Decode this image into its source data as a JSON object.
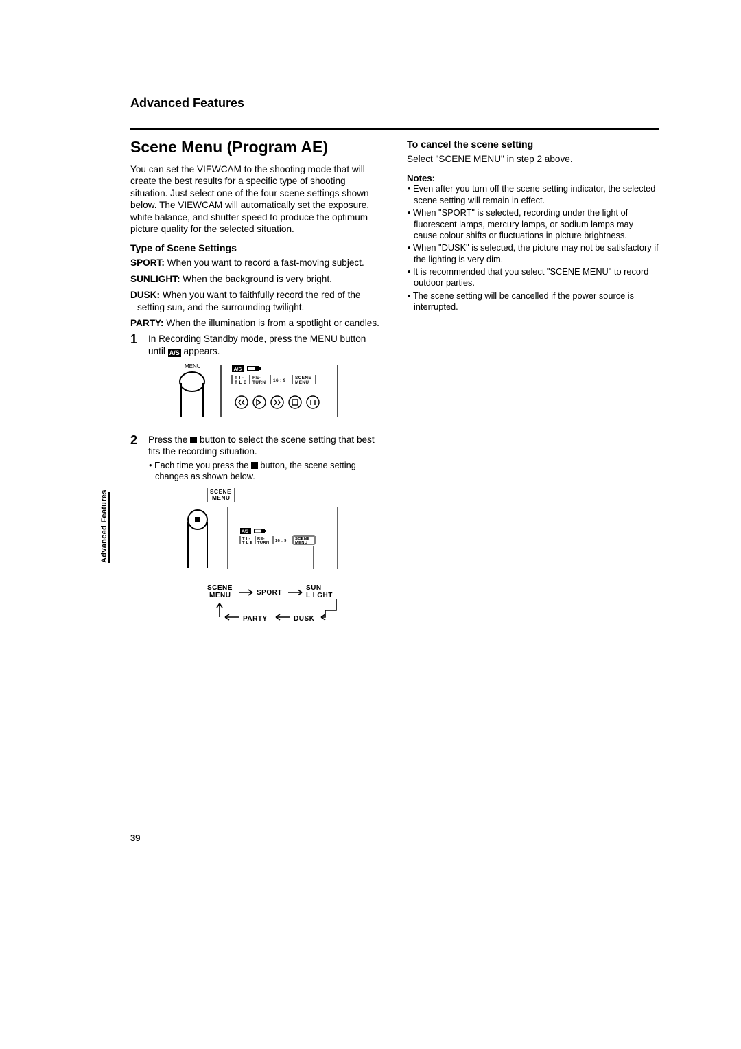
{
  "header": {
    "section": "Advanced Features"
  },
  "left": {
    "title": "Scene Menu (Program AE)",
    "intro": "You can set the VIEWCAM to the shooting mode that will create the best results for a specific type of shooting situation. Just select one of the four scene settings shown below. The VIEWCAM will automatically set the exposure, white balance, and shutter speed to produce the optimum picture quality for the selected situation.",
    "type_head": "Type of Scene Settings",
    "types": [
      {
        "name": "SPORT:",
        "desc": " When you want to record a fast-moving subject."
      },
      {
        "name": "SUNLIGHT:",
        "desc": " When the background is very bright."
      },
      {
        "name": "DUSK:",
        "desc": " When you want to faithfully record the red of the setting sun, and the surrounding twilight."
      },
      {
        "name": "PARTY:",
        "desc": " When the illumination is from a spotlight or candles."
      }
    ],
    "step1_a": "In Recording Standby mode, press the MENU button until ",
    "step1_b": " appears.",
    "step2_main_a": "Press the ",
    "step2_main_b": " button to select the scene setting that best fits the recording situation.",
    "step2_sub_a": "• Each time you press the ",
    "step2_sub_b": " button, the scene setting changes as shown below."
  },
  "right": {
    "cancel_head": "To cancel the scene setting",
    "cancel_body": "Select \"SCENE MENU\" in step 2 above.",
    "notes_head": "Notes:",
    "notes": [
      "Even after you turn off the scene setting indicator, the selected scene setting will remain in effect.",
      "When \"SPORT\" is selected, recording under the light of fluorescent lamps, mercury lamps, or sodium lamps may cause colour shifts or fluctuations in picture brightness.",
      "When \"DUSK\" is selected, the picture may not be satisfactory if the lighting is very dim.",
      "It is recommended that you select \"SCENE MENU\" to record outdoor parties.",
      "The scene setting will be cancelled if the power source is interrupted."
    ]
  },
  "figures": {
    "menu_label": "MENU",
    "bar_items": [
      "T I -\nT L E",
      "RE-\nTURN",
      "16 : 9",
      "SCENE\nMENU"
    ],
    "stop_circle_legend": "SCENE\nMENU",
    "cycle": [
      "SCENE\nMENU",
      "SPORT",
      "SUN\nL I GHT",
      "DUSK",
      "PARTY"
    ]
  },
  "tab": "Advanced Features",
  "page_number": "39"
}
